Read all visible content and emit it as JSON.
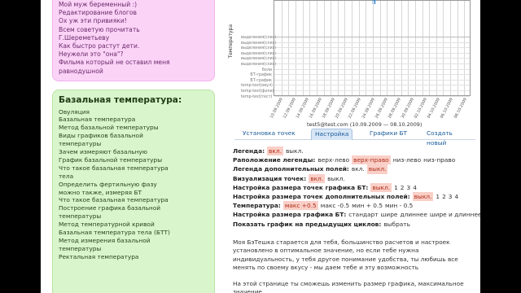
{
  "sidebar": {
    "pink_links": [
      "Мой муж беременный :)",
      "Редактирование блогов",
      "Ох уж эти привияки!",
      "Всем советую прочитать",
      "Г.Шереметьеву",
      "Как быстро растут дети.",
      "Неужели это \"она\"?",
      "Фильма который не оставил меня",
      "равнодушной"
    ],
    "green_title": "Базальная температура:",
    "green_links": [
      "Овуляция",
      "Базальная температура",
      "Метод базальной температуры",
      "Виды графиков базальной",
      "температуры",
      "Зачем измеряют базальную",
      "График базальной температуры",
      "Что такое базальная температура",
      "тела",
      "Определить фертильную фазу",
      "можно также, измеряя БТ",
      "Что такое базальная температура",
      "Построение графика базальной",
      "температуры",
      "Метод температурной кривой",
      "Базальная температура тела (БТТ)",
      "Метод измерения базальной",
      "температуры",
      "Ректальная температура"
    ]
  },
  "chart": {
    "ylabel": "Температура",
    "point_label": "8",
    "row_labels": [
      "выделения(слиз)",
      "выделения(слиз)",
      "выделения(слиз)",
      "выделения(слиз)",
      "выделения(слиз)",
      "выделения(слиз)",
      "боли",
      "БТ-график",
      "БТ-график",
      "temp-test(овул)",
      "temp-test(фоли)",
      "temp-test(тест)"
    ],
    "x_ticks": [
      "10.09.2009",
      "12.09.2009",
      "14.09.2009",
      "16.09.2009",
      "18.09.2009",
      "20.09.2009",
      "22.09.2009",
      "24.09.2009",
      "26.09.2009",
      "28.09.2009",
      "30.09.2009",
      "02.10.2009",
      "04.10.2009",
      "06.10.2009",
      "08.10.2009"
    ],
    "caption": "test5@test.com (10.09.2009 — 08.10.2009)"
  },
  "tabs": [
    {
      "label": "Установка точек",
      "active": false
    },
    {
      "label": "Настройка",
      "active": true
    },
    {
      "label": "Графики БТ",
      "active": false
    },
    {
      "label": "Создать новый",
      "active": false
    }
  ],
  "settings": {
    "legend": {
      "label": "Легенда",
      "options": [
        "вкл.",
        "выкл."
      ],
      "selected": 0
    },
    "legend_pos": {
      "label": "Раположение легенды",
      "options": [
        "верх-лево",
        "верх-право",
        "низ-лево",
        "низ-право"
      ],
      "selected": 1
    },
    "extra_fields": {
      "label": "Легенда дополнительных полей",
      "options": [
        "вкл.",
        "выкл."
      ],
      "selected": 1
    },
    "points_vis": {
      "label": "Визуализация точек",
      "options": [
        "вкл.",
        "выкл."
      ],
      "selected": 0
    },
    "point_size": {
      "label": "Настройка размера точек графика БТ",
      "options": [
        "выкл.",
        "1",
        "2",
        "3",
        "4"
      ],
      "selected": 0
    },
    "extra_point_size": {
      "label": "Настройка размера точек дополнительных полей",
      "options": [
        "выкл.",
        "1",
        "2",
        "3",
        "4"
      ],
      "selected": 0
    },
    "temperature": {
      "label": "Температура",
      "options": [
        "макс +0.5",
        "макс -0.5",
        "мин + 0.5",
        "мин - 0.5"
      ],
      "selected": 0
    },
    "chart_size": {
      "label": "Настройка размера графика БТ",
      "options": [
        "стандарт",
        "шире",
        "длиннее",
        "шире и длиннее"
      ],
      "selected": -1
    },
    "prev_cycles": {
      "label": "Показать график на предыдущих циклов",
      "link": "выбрать"
    }
  },
  "paragraphs": {
    "p1": "Моя БэТешка старается для тебя, большинство расчетов и настроек установлено в оптимальное значение, но если тебе нужна индивидуальность, у тебя другое понимание удобства, ты любишь все менять по своему вкусу - мы даем тебе и эту возможность",
    "p2": "На этой странице ты сможешь изменить размер графика, максимальное значение"
  }
}
